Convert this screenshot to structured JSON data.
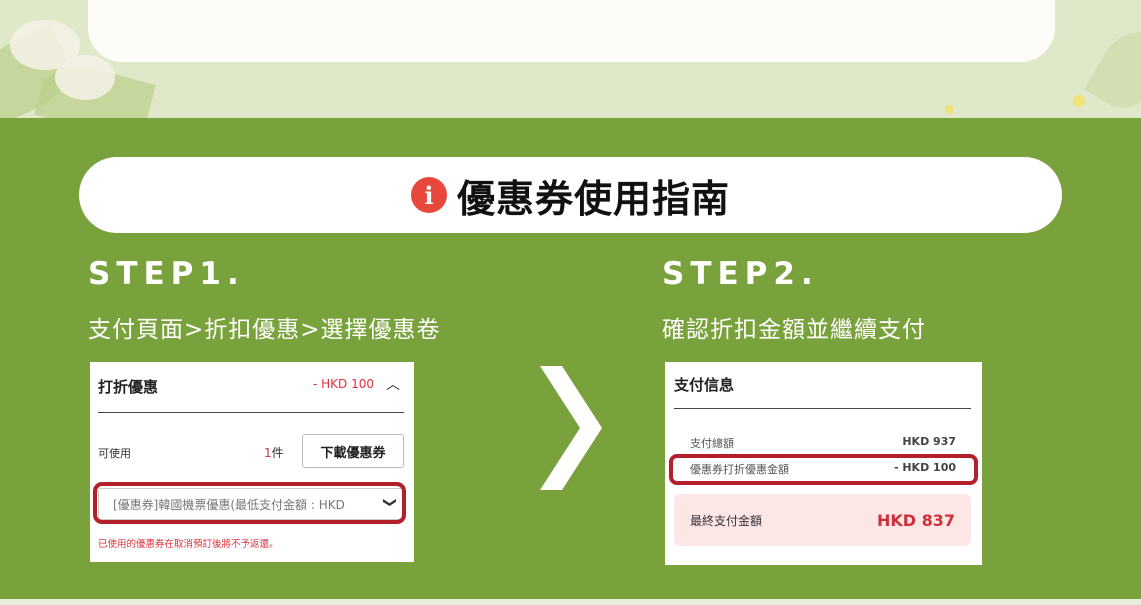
{
  "guide": {
    "title": "優惠券使用指南",
    "info_icon": "i"
  },
  "step1": {
    "heading": "STEP1.",
    "subtitle": "支付頁面>折扣優惠>選擇優惠卷",
    "panel": {
      "header": "打折優惠",
      "discount_amount": "- HKD 100",
      "caret": "︿",
      "usable_label": "可使用",
      "count_number": "1",
      "count_unit": "件",
      "download_button": "下載優惠券",
      "coupon_select": "[優惠券]韓國機票優惠(最低支付金額 : HKD",
      "chevron": "❯",
      "note": "已使用的優惠券在取消預訂後將不予返還。"
    }
  },
  "step2": {
    "heading": "STEP2.",
    "subtitle": "確認折扣金額並繼續支付",
    "panel": {
      "header": "支付信息",
      "total_label": "支付總額",
      "total_value": "HKD 937",
      "discount_label": "優惠券打折優惠金額",
      "discount_value": "- HKD 100",
      "final_label": "最終支付金額",
      "final_value": "HKD 837"
    }
  },
  "colors": {
    "background_green": "#7aa23c",
    "highlight_red": "#b4202a",
    "price_red": "#d1303a"
  }
}
